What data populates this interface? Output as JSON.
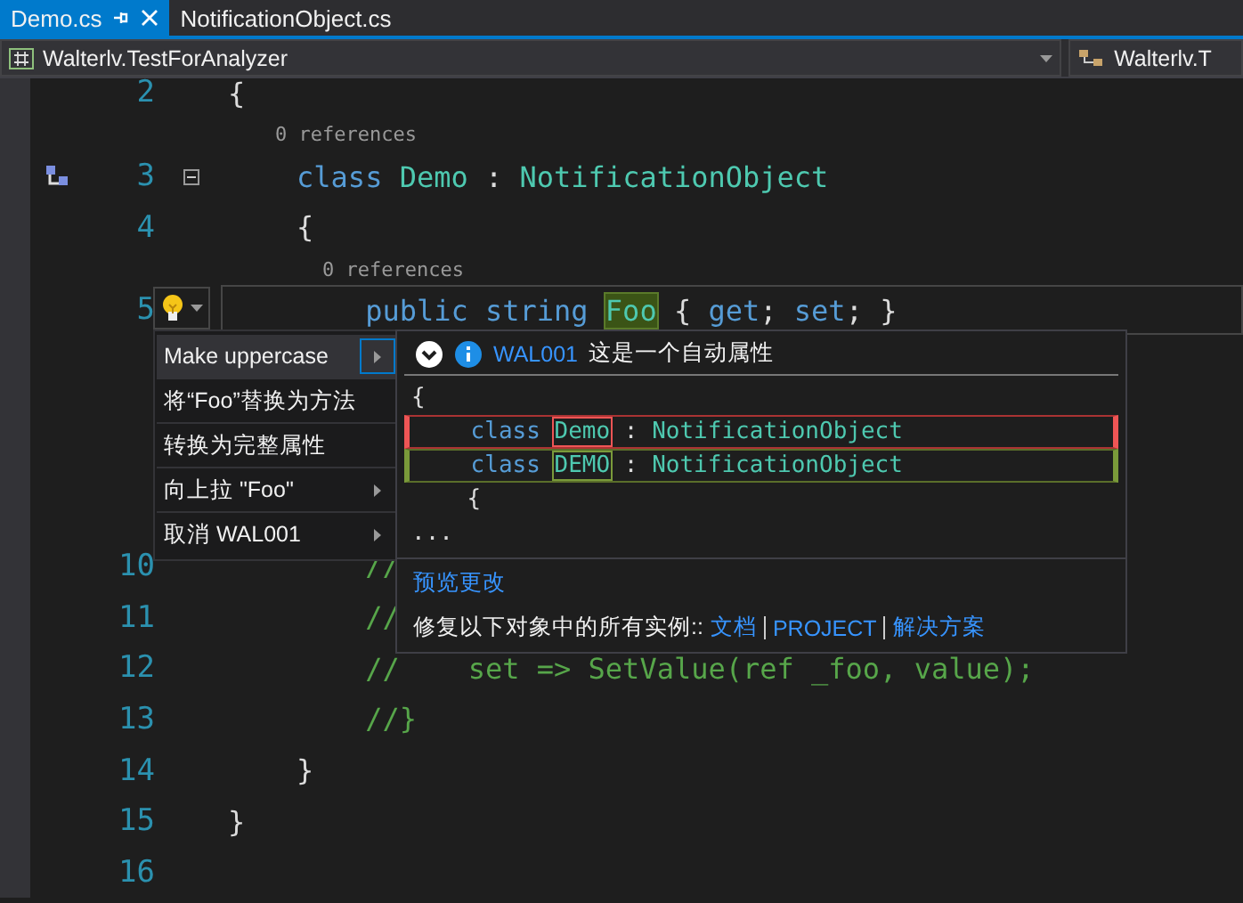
{
  "tabs": [
    {
      "label": "Demo.cs",
      "selected": true,
      "pinned": true
    },
    {
      "label": "NotificationObject.cs",
      "selected": false,
      "pinned": false
    }
  ],
  "navbar": {
    "project": "Walterlv.TestForAnalyzer",
    "member": "Walterlv.T"
  },
  "lines": [
    {
      "kind": "code",
      "number": "2",
      "glyph": false,
      "foldable": false,
      "current": false,
      "tokens": [
        {
          "text": "{",
          "kind": "plain"
        }
      ]
    },
    {
      "kind": "code",
      "number": "3",
      "codelens": "0 references",
      "glyph": true,
      "foldable": true,
      "current": false,
      "tokens": [
        {
          "text": "    class ",
          "kind": "keyword"
        },
        {
          "text": "Demo",
          "kind": "type"
        },
        {
          "text": " : ",
          "kind": "plain"
        },
        {
          "text": "NotificationObject",
          "kind": "type"
        }
      ]
    },
    {
      "kind": "code",
      "number": "4",
      "glyph": false,
      "foldable": false,
      "current": false,
      "tokens": [
        {
          "text": "    {",
          "kind": "plain"
        }
      ]
    },
    {
      "kind": "code",
      "number": "5",
      "codelens": "0 references",
      "glyph": false,
      "foldable": false,
      "current": true,
      "tokens": [
        {
          "text": "        public string ",
          "kind": "keyword"
        },
        {
          "text": "Foo",
          "kind": "highlight"
        },
        {
          "text": " { ",
          "kind": "plain"
        },
        {
          "text": "get",
          "kind": "keyword"
        },
        {
          "text": "; ",
          "kind": "plain"
        },
        {
          "text": "set",
          "kind": "keyword"
        },
        {
          "text": "; }",
          "kind": "plain"
        }
      ]
    },
    {
      "kind": "blank"
    },
    {
      "kind": "blank"
    },
    {
      "kind": "blank"
    },
    {
      "kind": "blank"
    },
    {
      "kind": "code",
      "number": "10",
      "glyph": false,
      "foldable": false,
      "current": false,
      "tokens": [
        {
          "text": "        //",
          "kind": "comment"
        }
      ]
    },
    {
      "kind": "code",
      "number": "11",
      "glyph": false,
      "foldable": false,
      "current": false,
      "tokens": [
        {
          "text": "        //",
          "kind": "comment"
        }
      ]
    },
    {
      "kind": "code",
      "number": "12",
      "glyph": false,
      "foldable": false,
      "current": false,
      "tokens": [
        {
          "text": "        //    set => SetValue(ref _foo, value);",
          "kind": "comment"
        }
      ]
    },
    {
      "kind": "code",
      "number": "13",
      "glyph": false,
      "foldable": false,
      "current": false,
      "tokens": [
        {
          "text": "        //}",
          "kind": "comment"
        }
      ]
    },
    {
      "kind": "code",
      "number": "14",
      "glyph": false,
      "foldable": false,
      "current": false,
      "tokens": [
        {
          "text": "    }",
          "kind": "plain"
        }
      ]
    },
    {
      "kind": "code",
      "number": "15",
      "glyph": false,
      "foldable": false,
      "current": false,
      "tokens": [
        {
          "text": "}",
          "kind": "plain"
        }
      ]
    },
    {
      "kind": "code",
      "number": "16",
      "glyph": false,
      "foldable": false,
      "current": false
    }
  ],
  "menu": [
    {
      "label": "Make uppercase",
      "selected": true,
      "submenu": true
    },
    {
      "label": "将“Foo”替换为方法",
      "selected": false,
      "submenu": false
    },
    {
      "label": "转换为完整属性",
      "selected": false,
      "submenu": false
    },
    {
      "label": "向上拉 \"Foo\"",
      "selected": false,
      "submenu": true
    },
    {
      "label": "取消 WAL001",
      "selected": false,
      "submenu": true
    }
  ],
  "preview": {
    "code": "WAL001",
    "message": "这是一个自动属性",
    "diff": [
      {
        "kind": "context",
        "tokens": [
          {
            "text": "{",
            "kind": "plain"
          }
        ]
      },
      {
        "kind": "removed",
        "tokens": [
          {
            "text": "    class ",
            "kind": "keyword"
          },
          {
            "text": "Demo",
            "kind": "changed"
          },
          {
            "text": " : ",
            "kind": "plain"
          },
          {
            "text": "NotificationObject",
            "kind": "type"
          }
        ]
      },
      {
        "kind": "added",
        "tokens": [
          {
            "text": "    class ",
            "kind": "keyword"
          },
          {
            "text": "DEMO",
            "kind": "changed"
          },
          {
            "text": " : ",
            "kind": "plain"
          },
          {
            "text": "NotificationObject",
            "kind": "type"
          }
        ]
      },
      {
        "kind": "context",
        "tokens": [
          {
            "text": "    {",
            "kind": "plain"
          }
        ]
      },
      {
        "kind": "context",
        "tokens": [
          {
            "text": "...",
            "kind": "plain"
          }
        ]
      }
    ],
    "preview_link": "预览更改",
    "fix_all_label": "修复以下对象中的所有实例::",
    "scopes": [
      "文档",
      "PROJECT",
      "解决方案"
    ]
  }
}
